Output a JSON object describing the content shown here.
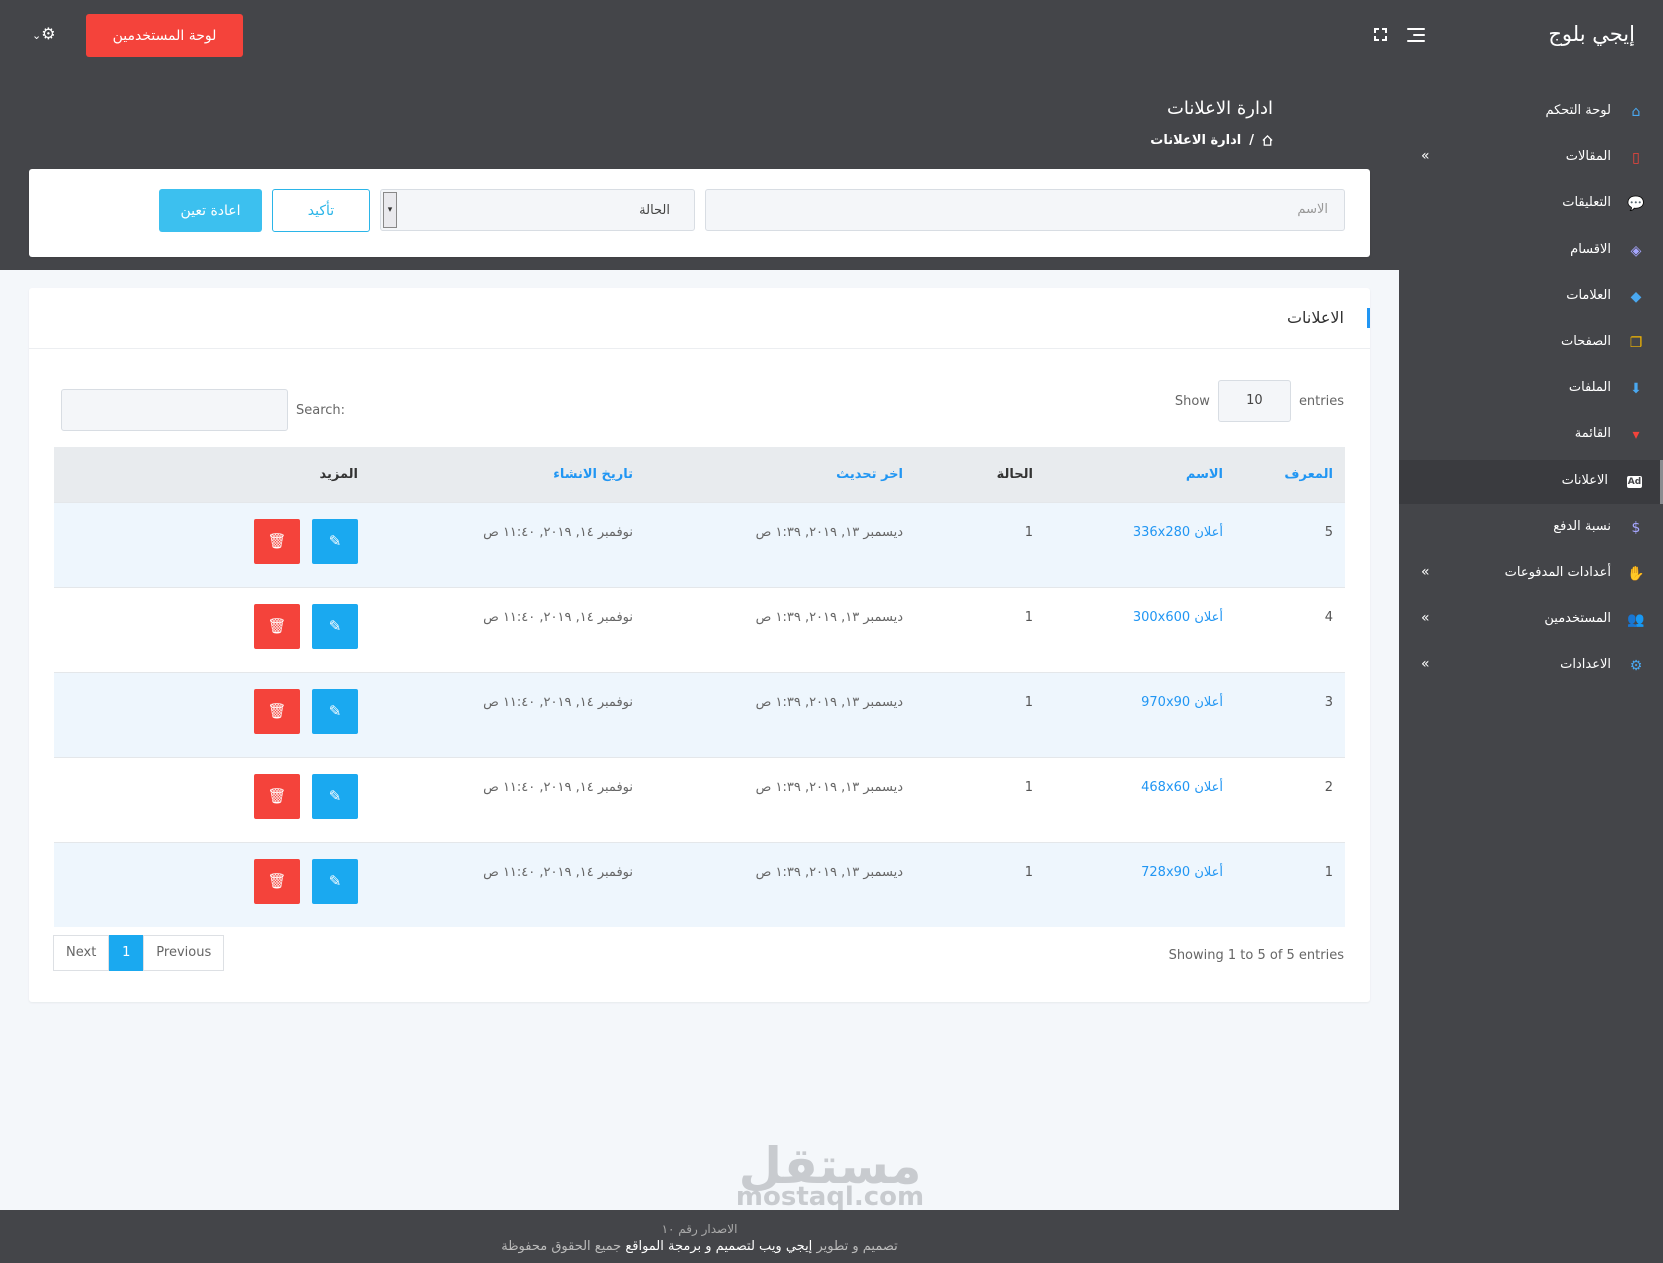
{
  "app": {
    "brand": "إيجي بلوج"
  },
  "topbar": {
    "dashboard_button": "لوحة المستخدمين"
  },
  "header": {
    "title": "ادارة الاعلانات",
    "breadcrumb": "ادارة الاعلانات"
  },
  "filters": {
    "name_placeholder": "الاسم",
    "status_label": "الحالة",
    "confirm_label": "تأكيد",
    "reset_label": "اعادة تعين"
  },
  "sidebar": {
    "items": [
      {
        "label": "لوحة التحكم",
        "icon": "home-icon",
        "color": "#4aa8f0",
        "glyph": "⌂",
        "arrow": false,
        "active": false
      },
      {
        "label": "المقالات",
        "icon": "file-icon",
        "color": "#f4433b",
        "glyph": "▯",
        "arrow": true,
        "active": false
      },
      {
        "label": "التعليقات",
        "icon": "comments-icon",
        "color": "#4aa8f0",
        "glyph": "💬",
        "arrow": false,
        "active": false
      },
      {
        "label": "الاقسام",
        "icon": "layers-icon",
        "color": "#a6a6ff",
        "glyph": "◈",
        "arrow": false,
        "active": false
      },
      {
        "label": "العلامات",
        "icon": "tags-icon",
        "color": "#4aa8f0",
        "glyph": "◆",
        "arrow": false,
        "active": false
      },
      {
        "label": "الصفحات",
        "icon": "copy-icon",
        "color": "#f5b800",
        "glyph": "❐",
        "arrow": false,
        "active": false
      },
      {
        "label": "الملفات",
        "icon": "download-icon",
        "color": "#4aa8f0",
        "glyph": "⬇",
        "arrow": false,
        "active": false
      },
      {
        "label": "القائمة",
        "icon": "menu-dropdown-icon",
        "color": "#f4433b",
        "glyph": "▾",
        "arrow": false,
        "active": false
      },
      {
        "label": "الاعلانات",
        "icon": "ad-icon",
        "color": "#ffffff",
        "glyph": "Ad",
        "arrow": false,
        "active": true
      },
      {
        "label": "نسبة الدفع",
        "icon": "dollar-icon",
        "color": "#a6a6ff",
        "glyph": "$",
        "arrow": false,
        "active": false
      },
      {
        "label": "أعدادات المدفوعات",
        "icon": "hand-money-icon",
        "color": "#4aa8f0",
        "glyph": "✋",
        "arrow": true,
        "active": false
      },
      {
        "label": "المستخدمين",
        "icon": "users-icon",
        "color": "#f5b800",
        "glyph": "👥",
        "arrow": true,
        "active": false
      },
      {
        "label": "الاعدادات",
        "icon": "cogs-icon",
        "color": "#4aa8f0",
        "glyph": "⚙",
        "arrow": true,
        "active": false
      }
    ]
  },
  "card": {
    "title": "الاعلانات",
    "show_label": "Show",
    "entries_label": "entries",
    "page_length": "10",
    "search_label": "Search:"
  },
  "table": {
    "columns": [
      "المعرف",
      "الاسم",
      "الحالة",
      "اخر تحديث",
      "تاريخ الانشاء",
      "المزيد"
    ],
    "rows": [
      {
        "id": "5",
        "name": "أعلان 336x280",
        "status": "1",
        "updated": "ديسمبر ١٣, ٢٠١٩, ١:٣٩ ص",
        "created": "نوفمبر ١٤, ٢٠١٩, ١١:٤٠ ص"
      },
      {
        "id": "4",
        "name": "أعلان 300x600",
        "status": "1",
        "updated": "ديسمبر ١٣, ٢٠١٩, ١:٣٩ ص",
        "created": "نوفمبر ١٤, ٢٠١٩, ١١:٤٠ ص"
      },
      {
        "id": "3",
        "name": "أعلان 970x90",
        "status": "1",
        "updated": "ديسمبر ١٣, ٢٠١٩, ١:٣٩ ص",
        "created": "نوفمبر ١٤, ٢٠١٩, ١١:٤٠ ص"
      },
      {
        "id": "2",
        "name": "أعلان 468x60",
        "status": "1",
        "updated": "ديسمبر ١٣, ٢٠١٩, ١:٣٩ ص",
        "created": "نوفمبر ١٤, ٢٠١٩, ١١:٤٠ ص"
      },
      {
        "id": "1",
        "name": "أعلان 728x90",
        "status": "1",
        "updated": "ديسمبر ١٣, ٢٠١٩, ١:٣٩ ص",
        "created": "نوفمبر ١٤, ٢٠١٩, ١١:٤٠ ص"
      }
    ]
  },
  "pagination": {
    "info": "Showing 1 to 5 of 5 entries",
    "previous": "Previous",
    "current": "1",
    "next": "Next"
  },
  "footer": {
    "version": "الاصدار رقم ١٠",
    "prefix": "تصميم و تطوير",
    "company": "إيجي ويب لتصميم و برمجة المواقع",
    "suffix": "جميع الحقوق محفوظة"
  },
  "watermark": {
    "arabic": "مستقل",
    "latin": "mostaql.com"
  },
  "colors": {
    "topbar": "#444549",
    "primary": "#1aa9f0",
    "danger": "#f4433b",
    "accent": "#2196f3"
  }
}
